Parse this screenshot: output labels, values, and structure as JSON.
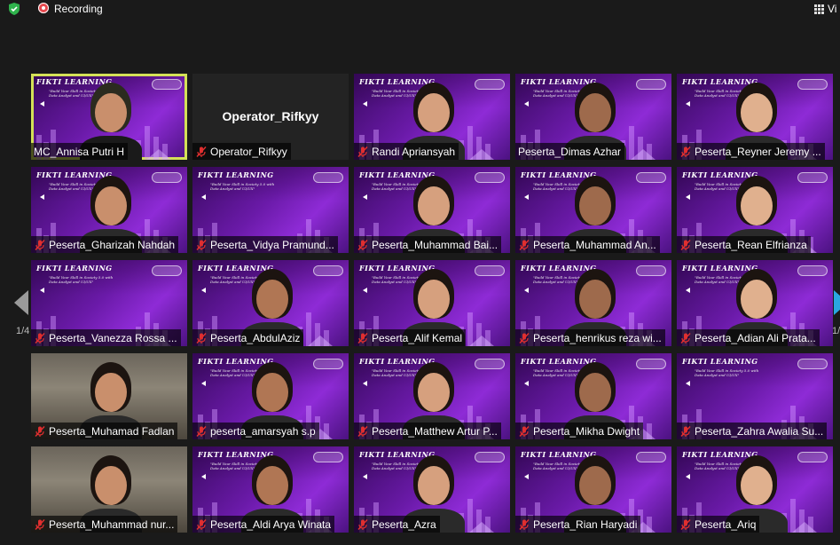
{
  "topbar": {
    "recording_label": "Recording",
    "view_label": "Vi"
  },
  "colors": {
    "accent_active": "#d4e157",
    "recording_red": "#e5484d",
    "shield_green": "#2fb24c",
    "mic_muted_red": "#e02f2f",
    "slide_purple": "#6a1aa8"
  },
  "pagination": {
    "left_indicator": "1/4",
    "right_indicator": "1/"
  },
  "slide": {
    "brand": "FIKTI LEARNING",
    "tagline": "\"Build Your Skill in Society 5.0 with Data Analyst and UI/UX\""
  },
  "tiles": [
    {
      "name": "MC_Annisa Putri H",
      "muted": false,
      "active": true,
      "kind": "purple-person"
    },
    {
      "name": "Operator_Rifkyy",
      "muted": true,
      "kind": "camera-off",
      "center_name": "Operator_Rifkyy"
    },
    {
      "name": "Randi Apriansyah",
      "muted": true,
      "kind": "purple-person"
    },
    {
      "name": "Peserta_Dimas Azhar",
      "muted": false,
      "kind": "purple-person"
    },
    {
      "name": "Peserta_Reyner Jeremy ...",
      "muted": true,
      "kind": "purple-person"
    },
    {
      "name": "Peserta_Gharizah Nahdah",
      "muted": true,
      "kind": "purple-person"
    },
    {
      "name": "Peserta_Vidya Pramund...",
      "muted": true,
      "kind": "purple"
    },
    {
      "name": "Peserta_Muhammad Bai...",
      "muted": true,
      "kind": "purple-person"
    },
    {
      "name": "Peserta_Muhammad An...",
      "muted": true,
      "kind": "purple-person"
    },
    {
      "name": "Peserta_Rean Elfrianza",
      "muted": true,
      "kind": "purple-person"
    },
    {
      "name": "Peserta_Vanezza Rossa ...",
      "muted": true,
      "kind": "purple"
    },
    {
      "name": "Peserta_AbdulAziz",
      "muted": true,
      "kind": "purple-person"
    },
    {
      "name": "Peserta_Alif Kemal",
      "muted": true,
      "kind": "purple-person"
    },
    {
      "name": "Peserta_henrikus reza wi...",
      "muted": true,
      "kind": "purple-person"
    },
    {
      "name": "Peserta_Adian Ali Prata...",
      "muted": true,
      "kind": "purple-person"
    },
    {
      "name": "Peserta_Muhamad Fadlan",
      "muted": true,
      "kind": "room-person"
    },
    {
      "name": "peserta_amarsyah s.p",
      "muted": true,
      "kind": "purple-person"
    },
    {
      "name": "Peserta_Matthew Artur P...",
      "muted": true,
      "kind": "purple-person"
    },
    {
      "name": "Peserta_Mikha Dwight",
      "muted": true,
      "kind": "purple-person"
    },
    {
      "name": "Peserta_Zahra Awalia Su...",
      "muted": true,
      "kind": "purple"
    },
    {
      "name": "Peserta_Muhammad nur...",
      "muted": true,
      "kind": "room-person"
    },
    {
      "name": "Peserta_Aldi Arya Winata",
      "muted": true,
      "kind": "purple-person"
    },
    {
      "name": "Peserta_Azra",
      "muted": true,
      "kind": "purple-person"
    },
    {
      "name": "Peserta_Rian Haryadi",
      "muted": true,
      "kind": "purple-person"
    },
    {
      "name": "Peserta_Ariq",
      "muted": true,
      "kind": "purple-person"
    }
  ]
}
